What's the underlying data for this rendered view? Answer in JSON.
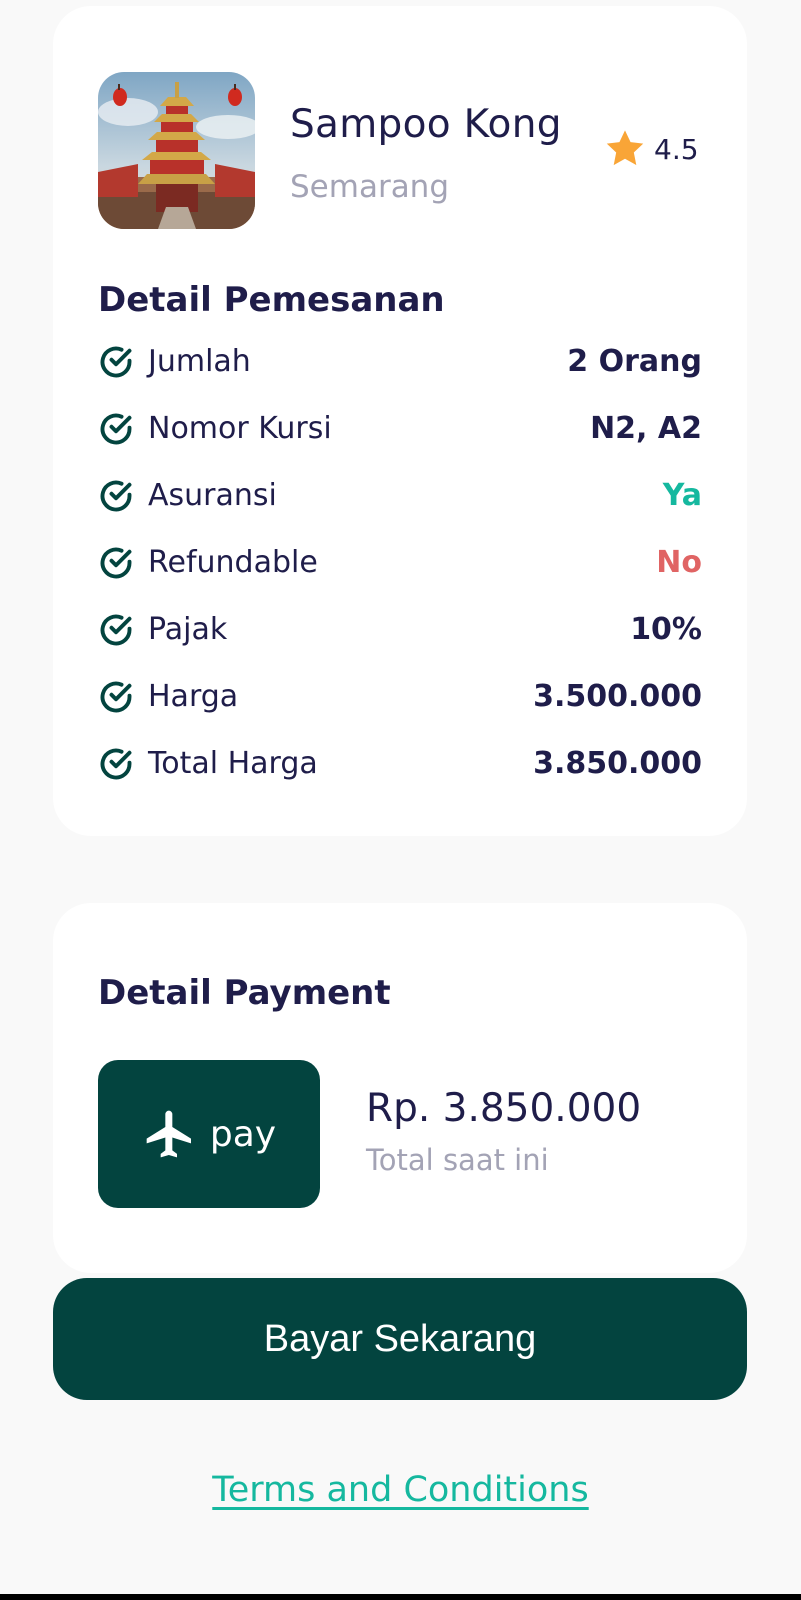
{
  "destination": {
    "name": "Sampoo Kong",
    "city": "Semarang",
    "rating": "4.5",
    "rating_icon": "star-icon"
  },
  "booking": {
    "title": "Detail Pemesanan",
    "rows": [
      {
        "label": "Jumlah",
        "value": "2 Orang"
      },
      {
        "label": "Nomor Kursi",
        "value": "N2, A2"
      },
      {
        "label": "Asuransi",
        "value": "Ya"
      },
      {
        "label": "Refundable",
        "value": "No"
      },
      {
        "label": "Pajak",
        "value": "10%"
      },
      {
        "label": "Harga",
        "value": "3.500.000"
      },
      {
        "label": "Total Harga",
        "value": "3.850.000"
      }
    ]
  },
  "payment": {
    "title": "Detail Payment",
    "logo_text": "pay",
    "amount": "Rp. 3.850.000",
    "amount_caption": "Total saat ini"
  },
  "actions": {
    "pay_now": "Bayar Sekarang",
    "terms": "Terms and Conditions"
  },
  "colors": {
    "primary": "#03443f",
    "text": "#1f1d4a",
    "muted": "#a3a3b5",
    "success": "#15b89f",
    "danger": "#e06464",
    "star": "#f9a537"
  }
}
